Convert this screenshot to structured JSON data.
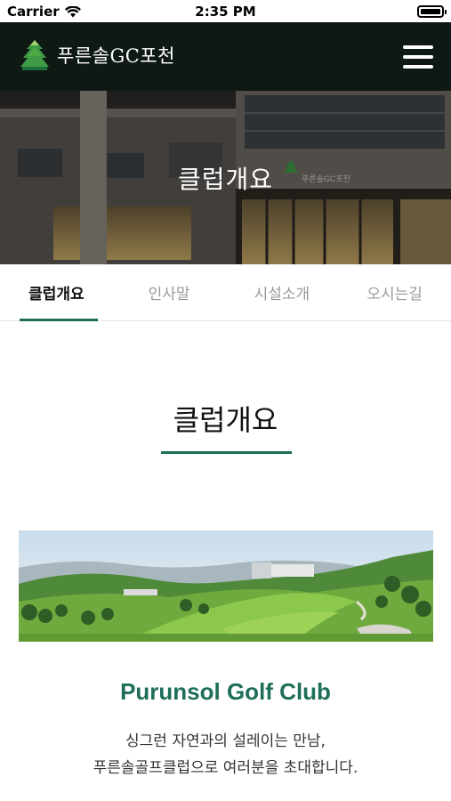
{
  "status_bar": {
    "carrier": "Carrier",
    "time": "2:35 PM"
  },
  "header": {
    "logo_text": "푸른솔GC포천",
    "menu_icon": "hamburger-menu-icon"
  },
  "hero": {
    "title": "클럽개요",
    "sign_text": "푸른솔GC포천"
  },
  "tabs": [
    {
      "label": "클럽개요",
      "active": true
    },
    {
      "label": "인사말",
      "active": false
    },
    {
      "label": "시설소개",
      "active": false
    },
    {
      "label": "오시는길",
      "active": false
    }
  ],
  "section": {
    "title": "클럽개요",
    "club_name": "Purunsol Golf Club",
    "tagline_line1": "싱그런 자연과의 설레이는 만남,",
    "tagline_line2": "푸른솔골프클럽으로 여러분을 초대합니다."
  },
  "colors": {
    "accent": "#1e6e5a",
    "header_bg": "#0f1914"
  }
}
